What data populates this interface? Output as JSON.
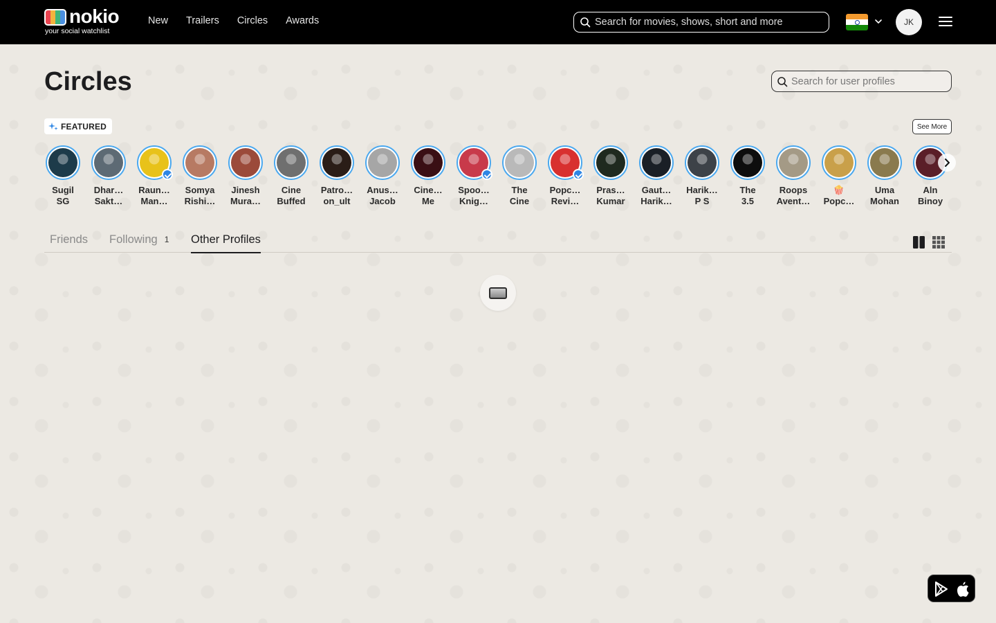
{
  "header": {
    "logo_word": "nokio",
    "logo_tagline": "your social watchlist",
    "nav": [
      "New",
      "Trailers",
      "Circles",
      "Awards"
    ],
    "search_placeholder": "Search for movies, shows, short and more",
    "country_flag": "india-flag-icon",
    "user_initials": "JK"
  },
  "page": {
    "title": "Circles",
    "profile_search_placeholder": "Search for user profiles"
  },
  "featured": {
    "badge_label": "FEATURED",
    "see_more_label": "See More",
    "profiles": [
      {
        "line1": "Sugil",
        "line2": "SG",
        "verified": false,
        "color": "#1d3b4a"
      },
      {
        "line1": "Dhar…",
        "line2": "Sakt…",
        "verified": false,
        "color": "#5d6a74"
      },
      {
        "line1": "Raun…",
        "line2": "Man…",
        "verified": true,
        "color": "#e8c21a"
      },
      {
        "line1": "Somya",
        "line2": "Rishi…",
        "verified": false,
        "color": "#b77a63"
      },
      {
        "line1": "Jinesh",
        "line2": "Mura…",
        "verified": false,
        "color": "#9b4a3a"
      },
      {
        "line1": "Cine",
        "line2": "Buffed",
        "verified": false,
        "color": "#6f6f6f"
      },
      {
        "line1": "Patro…",
        "line2": "on_ult",
        "verified": false,
        "color": "#2a1d17"
      },
      {
        "line1": "Anus…",
        "line2": "Jacob",
        "verified": false,
        "color": "#a6a6a6"
      },
      {
        "line1": "Cine…",
        "line2": "Me",
        "verified": false,
        "color": "#3a0f14"
      },
      {
        "line1": "Spoo…",
        "line2": "Knig…",
        "verified": true,
        "color": "#c83a4a"
      },
      {
        "line1": "The",
        "line2": "Cine",
        "verified": false,
        "color": "#b9b9b9"
      },
      {
        "line1": "Popc…",
        "line2": "Revi…",
        "verified": true,
        "color": "#d8302f"
      },
      {
        "line1": "Pras…",
        "line2": "Kumar",
        "verified": false,
        "color": "#1f2a1f"
      },
      {
        "line1": "Gaut…",
        "line2": "Harik…",
        "verified": false,
        "color": "#1a1f26"
      },
      {
        "line1": "Harik…",
        "line2": "P S",
        "verified": false,
        "color": "#3d4248"
      },
      {
        "line1": "The",
        "line2": "3.5",
        "verified": false,
        "color": "#0d0d0d"
      },
      {
        "line1": "Roops",
        "line2": "Avent…",
        "verified": false,
        "color": "#a49a86"
      },
      {
        "line1": "🍿",
        "line2": "Popc…",
        "verified": false,
        "color": "#c9a04a"
      },
      {
        "line1": "Uma",
        "line2": "Mohan",
        "verified": false,
        "color": "#8a7a4e"
      },
      {
        "line1": "Aln",
        "line2": "Binoy",
        "verified": false,
        "color": "#5a1e28"
      }
    ]
  },
  "tabs": [
    {
      "label": "Friends",
      "count": "",
      "active": false
    },
    {
      "label": "Following",
      "count": "1",
      "active": false
    },
    {
      "label": "Other Profiles",
      "count": "",
      "active": true
    }
  ],
  "colors": {
    "header_bg": "#000000",
    "page_bg": "#ece9e3",
    "ring_blue": "#4aa8ef",
    "verified_blue": "#2e86e5"
  }
}
